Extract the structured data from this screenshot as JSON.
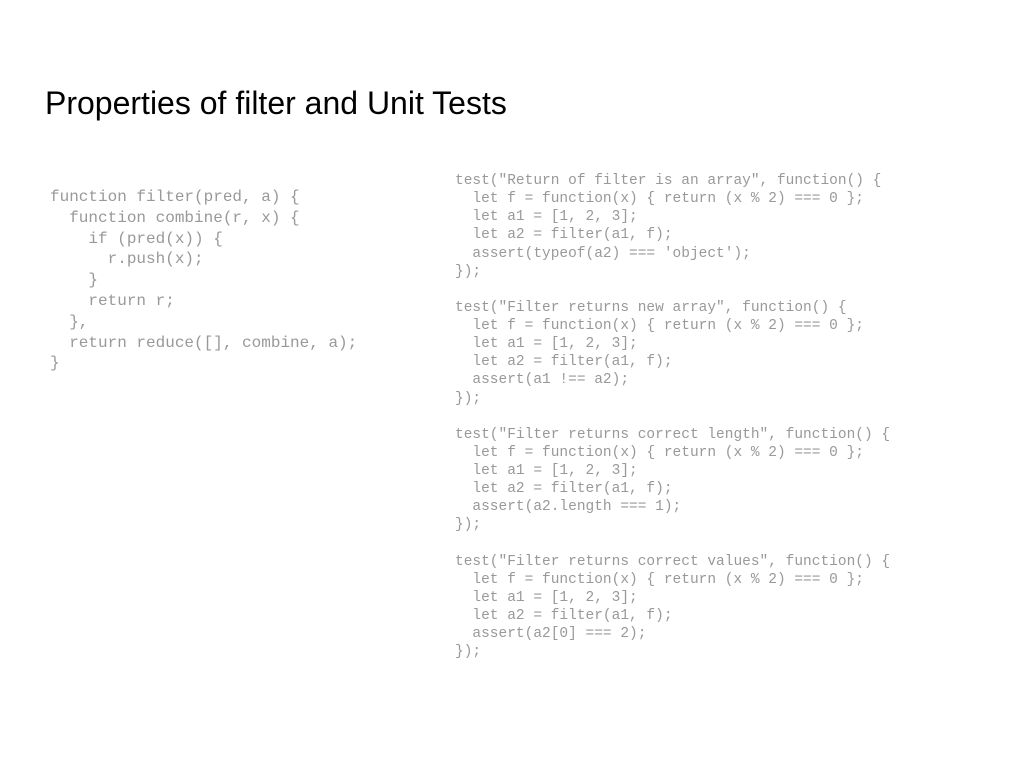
{
  "title": "Properties of filter and Unit Tests",
  "leftCode": "function filter(pred, a) {\n  function combine(r, x) {\n    if (pred(x)) {\n      r.push(x);\n    }\n    return r;\n  },\n  return reduce([], combine, a);\n}",
  "rightCode": "test(\"Return of filter is an array\", function() {\n  let f = function(x) { return (x % 2) === 0 };\n  let a1 = [1, 2, 3];\n  let a2 = filter(a1, f);\n  assert(typeof(a2) === 'object');\n});\n\ntest(\"Filter returns new array\", function() {\n  let f = function(x) { return (x % 2) === 0 };\n  let a1 = [1, 2, 3];\n  let a2 = filter(a1, f);\n  assert(a1 !== a2);\n});\n\ntest(\"Filter returns correct length\", function() {\n  let f = function(x) { return (x % 2) === 0 };\n  let a1 = [1, 2, 3];\n  let a2 = filter(a1, f);\n  assert(a2.length === 1);\n});\n\ntest(\"Filter returns correct values\", function() {\n  let f = function(x) { return (x % 2) === 0 };\n  let a1 = [1, 2, 3];\n  let a2 = filter(a1, f);\n  assert(a2[0] === 2);\n});"
}
